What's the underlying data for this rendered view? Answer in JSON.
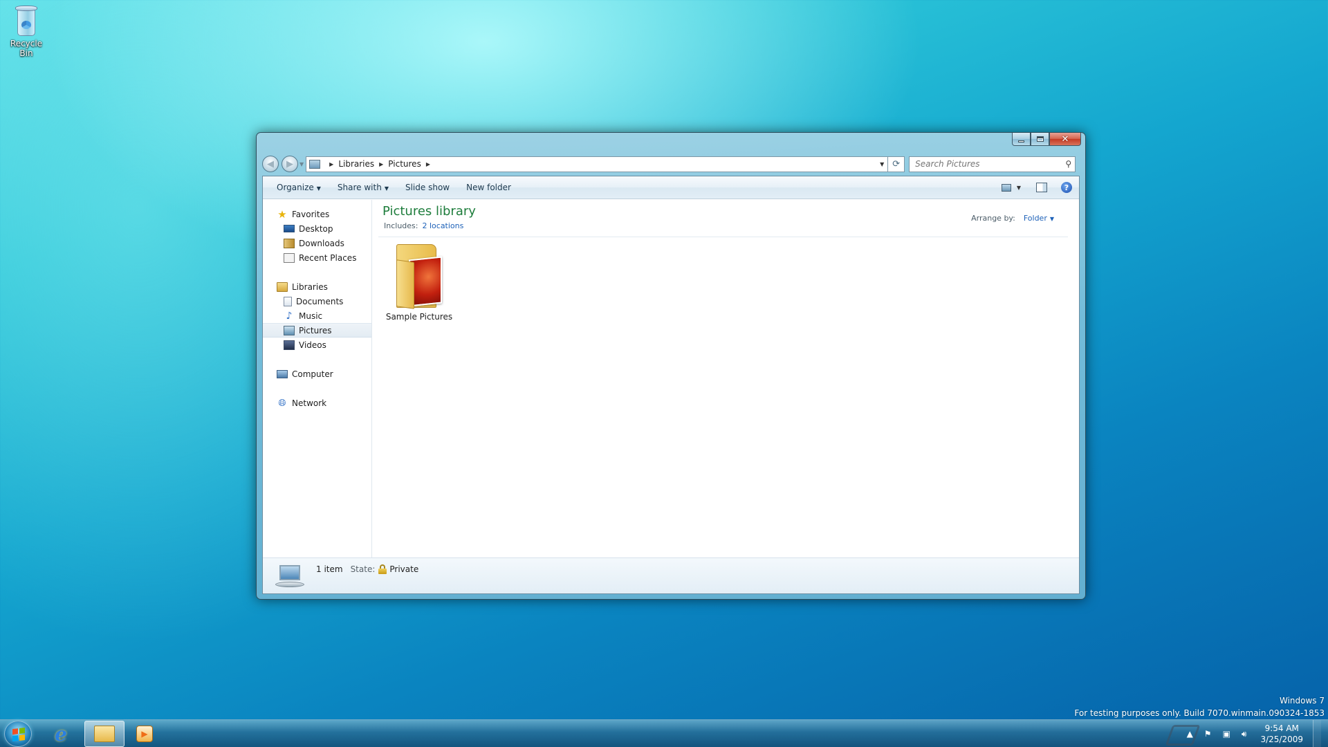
{
  "desktop": {
    "recycle_bin_label": "Recycle Bin",
    "watermark_line1": "Windows 7",
    "watermark_line2": "For testing purposes only. Build 7070.winmain.090324-1853"
  },
  "window": {
    "address": {
      "crumbs": [
        "Libraries",
        "Pictures"
      ],
      "search_placeholder": "Search Pictures"
    },
    "toolbar": {
      "organize": "Organize",
      "share_with": "Share with",
      "slide_show": "Slide show",
      "new_folder": "New folder"
    },
    "nav_pane": {
      "favorites": "Favorites",
      "desktop": "Desktop",
      "downloads": "Downloads",
      "recent_places": "Recent Places",
      "libraries": "Libraries",
      "documents": "Documents",
      "music": "Music",
      "pictures": "Pictures",
      "videos": "Videos",
      "computer": "Computer",
      "network": "Network",
      "selected": "Pictures"
    },
    "content": {
      "title": "Pictures library",
      "includes_label": "Includes:",
      "includes_link": "2 locations",
      "arrange_label": "Arrange by:",
      "arrange_value": "Folder",
      "items": [
        {
          "label": "Sample Pictures",
          "icon": "folder-with-pictures-icon"
        }
      ]
    },
    "status": {
      "count": "1 item",
      "state_label": "State:",
      "state_value": "Private"
    }
  },
  "taskbar": {
    "clock_time": "9:54 AM",
    "clock_date": "3/25/2009",
    "apps": [
      "internet-explorer-icon",
      "windows-explorer-icon",
      "media-player-icon"
    ]
  },
  "colors": {
    "library_title": "#1e7d3c",
    "link": "#1d61b8"
  }
}
